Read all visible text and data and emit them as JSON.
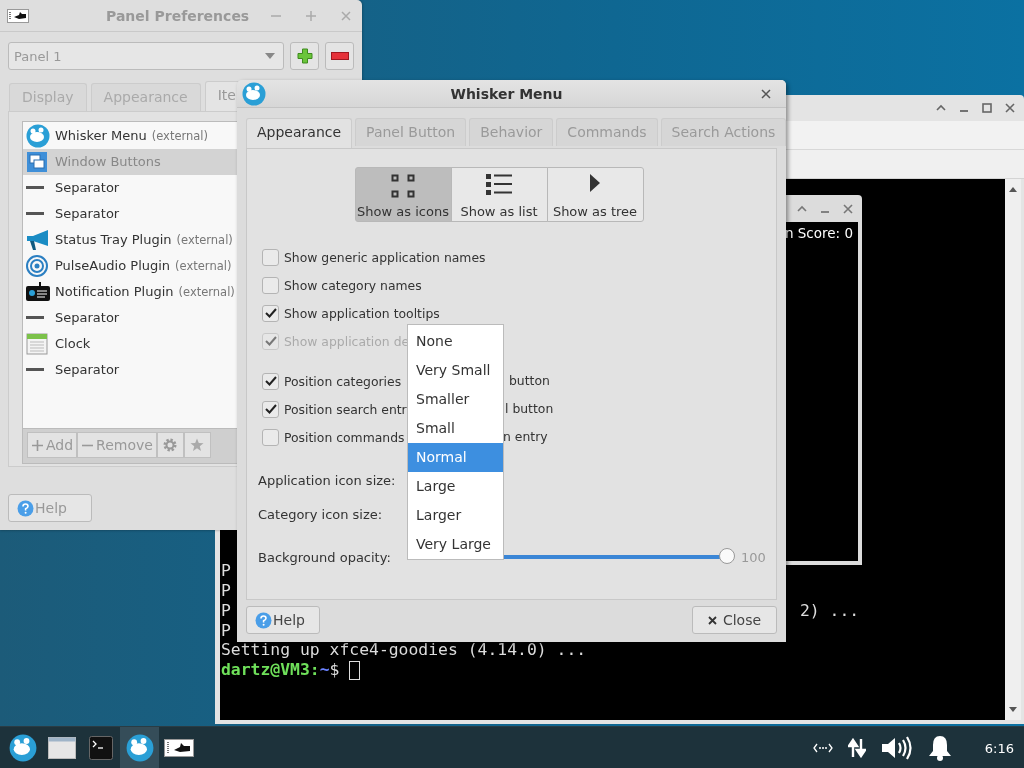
{
  "terminal_window": {
    "lines": [
      {
        "text": "P"
      },
      {
        "text": "P"
      },
      {
        "text": "P",
        "tail": "2) ..."
      },
      {
        "text": "P"
      },
      {
        "text": "Setting up xfce4-goodies (4.14.0) ..."
      }
    ],
    "prompt": {
      "user": "dartz@VM3",
      "separator": ":",
      "path": "~",
      "symbol": "$"
    }
  },
  "game_window": {
    "score_text": "n Score: 0"
  },
  "panel_preferences": {
    "title": "Panel Preferences",
    "panel_select": "Panel 1",
    "tabs": [
      {
        "label": "Display",
        "selected": false
      },
      {
        "label": "Appearance",
        "selected": false
      },
      {
        "label": "Ite",
        "selected": true
      }
    ],
    "items": [
      {
        "name": "Whisker Menu",
        "note": "(external)",
        "kind": "whisker",
        "selected": false
      },
      {
        "name": "Window Buttons",
        "kind": "windows",
        "selected": true
      },
      {
        "name": "Separator",
        "kind": "separator",
        "selected": false
      },
      {
        "name": "Separator",
        "kind": "separator",
        "selected": false
      },
      {
        "name": "Status Tray Plugin",
        "note": "(external)",
        "kind": "tray",
        "selected": false
      },
      {
        "name": "PulseAudio Plugin",
        "note": "(external)",
        "kind": "audio",
        "selected": false
      },
      {
        "name": "Notification Plugin",
        "note": "(external)",
        "kind": "notification",
        "selected": false
      },
      {
        "name": "Separator",
        "kind": "separator",
        "selected": false
      },
      {
        "name": "Clock",
        "kind": "clock",
        "selected": false
      },
      {
        "name": "Separator",
        "kind": "separator",
        "selected": false
      }
    ],
    "toolbar": {
      "add": "Add",
      "remove": "Remove"
    },
    "help": "Help"
  },
  "whisker_dialog": {
    "title": "Whisker Menu",
    "tabs": [
      {
        "label": "Appearance",
        "selected": true
      },
      {
        "label": "Panel Button",
        "selected": false
      },
      {
        "label": "Behavior",
        "selected": false
      },
      {
        "label": "Commands",
        "selected": false
      },
      {
        "label": "Search Actions",
        "selected": false
      }
    ],
    "view_modes": [
      {
        "label": "Show as icons",
        "kind": "icons",
        "selected": true
      },
      {
        "label": "Show as list",
        "kind": "list",
        "selected": false
      },
      {
        "label": "Show as tree",
        "kind": "tree",
        "selected": false
      }
    ],
    "checkbox_groups": [
      [
        {
          "label": "Show generic application names",
          "checked": false,
          "disabled": false
        },
        {
          "label": "Show category names",
          "checked": false,
          "disabled": false
        },
        {
          "label": "Show application tooltips",
          "checked": true,
          "disabled": false
        },
        {
          "label": "Show application de",
          "checked": true,
          "disabled": true
        }
      ],
      [
        {
          "label": "Position categories",
          "tail": "button",
          "checked": true,
          "disabled": false
        },
        {
          "label": "Position search entr",
          "tail": "l button",
          "checked": true,
          "disabled": false
        },
        {
          "label": "Position commands",
          "tail": "n entry",
          "checked": false,
          "disabled": false
        }
      ]
    ],
    "settings": [
      {
        "kind": "label",
        "label": "Application icon size:"
      },
      {
        "kind": "label",
        "label": "Category icon size:"
      },
      {
        "kind": "slider",
        "label": "Background opacity:",
        "level": 1,
        "reading": "100"
      }
    ],
    "help": "Help",
    "close": "Close",
    "icon_size_menu": [
      {
        "label": "None",
        "selected": false
      },
      {
        "label": "Very Small",
        "selected": false
      },
      {
        "label": "Smaller",
        "selected": false
      },
      {
        "label": "Small",
        "selected": false
      },
      {
        "label": "Normal",
        "selected": true
      },
      {
        "label": "Large",
        "selected": false
      },
      {
        "label": "Larger",
        "selected": false
      },
      {
        "label": "Very Large",
        "selected": false
      }
    ]
  },
  "taskbar": {
    "clock": "6:16"
  }
}
